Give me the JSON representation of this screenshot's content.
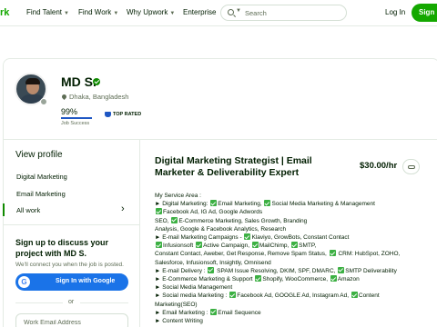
{
  "nav": {
    "logo": "rk",
    "items": [
      {
        "label": "Find Talent",
        "dropdown": true
      },
      {
        "label": "Find Work",
        "dropdown": true
      },
      {
        "label": "Why Upwork",
        "dropdown": true
      },
      {
        "label": "Enterprise",
        "dropdown": false
      }
    ],
    "search_placeholder": "Search",
    "login": "Log In",
    "signup": "Sign"
  },
  "profile": {
    "name": "MD S.",
    "location": "Dhaka, Bangladesh",
    "job_success": "99%",
    "job_success_value": 0.99,
    "job_success_label": "Job Success",
    "badge": "TOP RATED"
  },
  "sidebar": {
    "title": "View profile",
    "items": [
      {
        "label": "Digital Marketing"
      },
      {
        "label": "Email Marketing"
      },
      {
        "label": "All work"
      }
    ]
  },
  "cta": {
    "title": "Sign up to discuss your project with MD S.",
    "subtitle": "We'll connect you when the job is posted.",
    "google_label": "Sign In with Google",
    "or": "or",
    "email_placeholder": "Work Email Address"
  },
  "main": {
    "headline": "Digital Marketing Strategist | Email Marketer & Deliverability Expert",
    "rate": "$30.00/hr",
    "overview": [
      "My Service Area :",
      "► Digital Marketing: [✓]Email Marketing, [✓]Social Media Marketing & Management",
      "[✓]Facebook Ad, IG Ad, Google Adwords",
      "SEO, [✓]E-Commerce Marketing, Sales Growth, Branding",
      "Analysis, Google & Facebook Analytics, Research",
      "► E-mail Marketing Campaigns - [✓]Klaviyo, GrowBots, Constant Contact",
      "[✓]Infusionsoft [✓]Active Campaign, [✓]MailChimp, [✓]SMTP,",
      "Constant Contact, Aweber, Get Response, Remove Spam Status, [✓] CRM: HubSpot, ZOHO,",
      "Salesforce, Infusionsoft, Insightly, Omnisend",
      "► E-mail Delivery : [✓] SPAM Issue Resolving, DKIM, SPF, DMARC, [✓]SMTP Deliverability",
      "► E-Commerce Marketing & Support [✓]Shopify, WooCommerce, [✓]Amazon",
      "► Social Media Management",
      "► Social media Marketing : [✓]Facebook Ad, GOOGLE Ad, Instagram Ad, [✓]Content",
      "Marketing(SEO)",
      "► Email Marketing : [✓]Email Sequence",
      "► Content Writing"
    ]
  }
}
